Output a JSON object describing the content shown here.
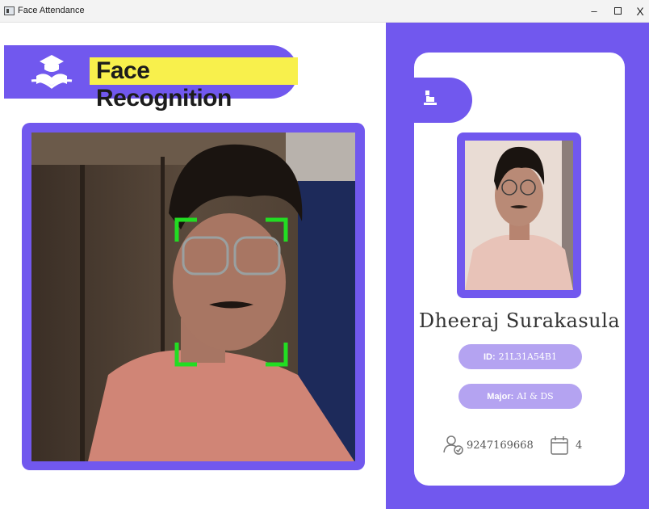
{
  "window": {
    "title": "Face Attendance",
    "minimize_glyph": "–",
    "close_glyph": "X"
  },
  "header": {
    "title": "Face Recognition",
    "logo_icon": "graduation-reading-icon"
  },
  "camera": {
    "detection_color": "#22dd22"
  },
  "colors": {
    "accent": "#7158ee",
    "pill": "#b4a3f1",
    "highlight": "#f8f04c"
  },
  "student": {
    "name": "Dheeraj Surakasula",
    "id_label": "ID:",
    "id_value": "21L31A54B1",
    "major_label": "Major:",
    "major_value": "AI & DS",
    "phone": "9247169668",
    "attendance_count": "4"
  }
}
